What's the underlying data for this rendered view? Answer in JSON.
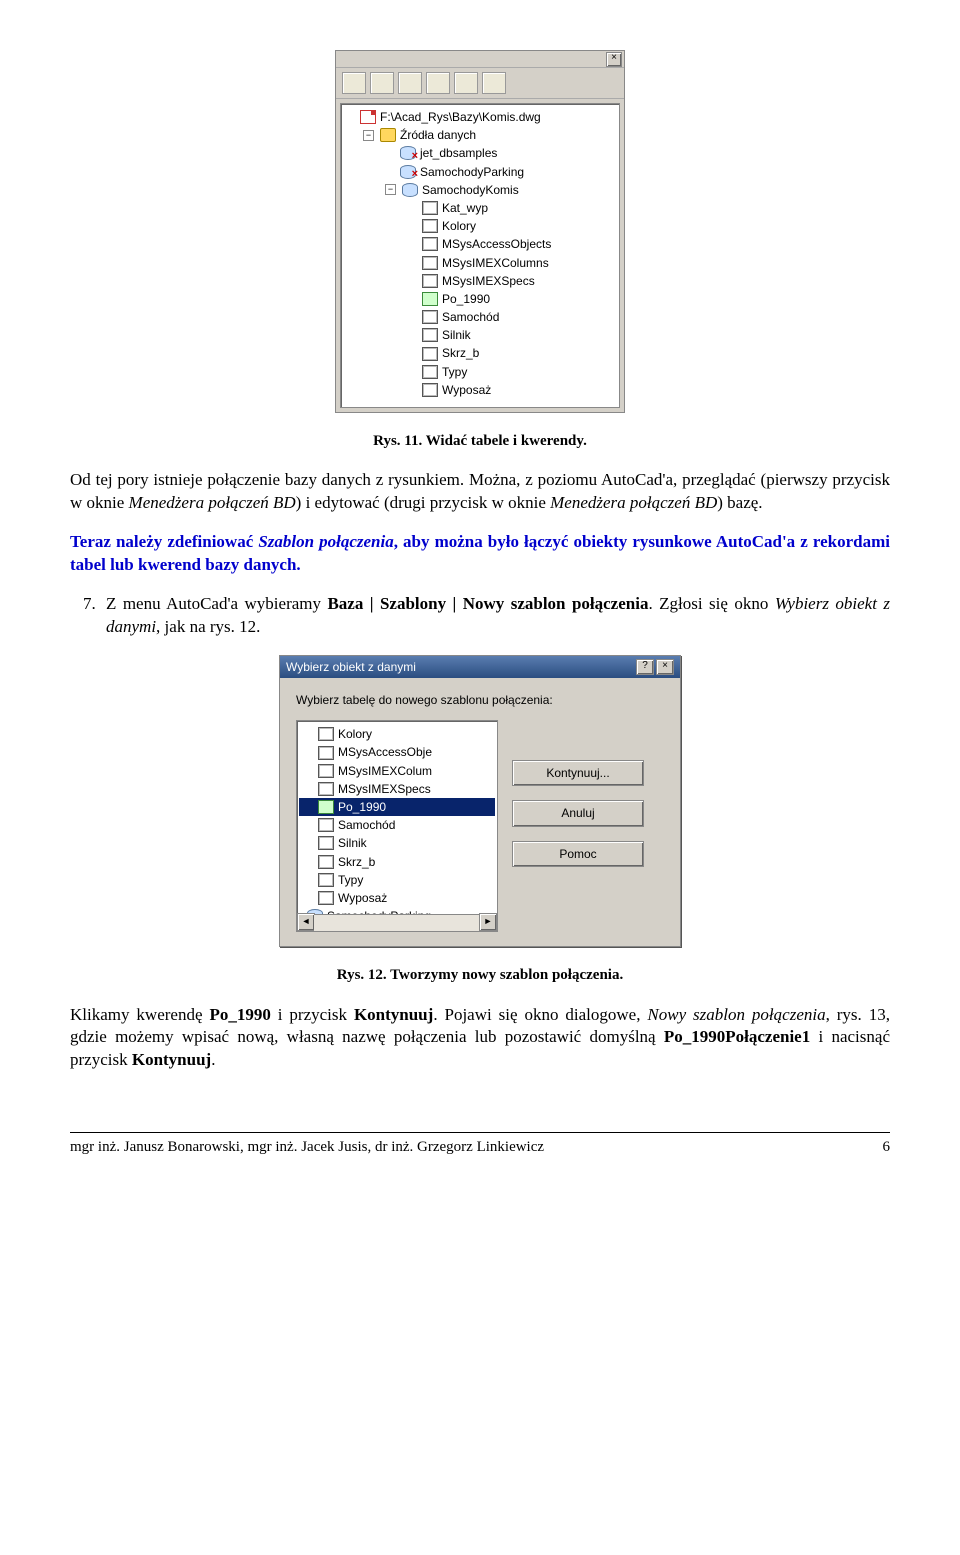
{
  "panel1": {
    "file_path": "F:\\Acad_Rys\\Bazy\\Komis.dwg",
    "root_label": "Źródła danych",
    "sources": [
      {
        "name": "jet_dbsamples",
        "broken": true
      },
      {
        "name": "SamochodyParking",
        "broken": true
      },
      {
        "name": "SamochodyKomis",
        "broken": false
      }
    ],
    "komis_children": [
      {
        "name": "Kat_wyp",
        "type": "table"
      },
      {
        "name": "Kolory",
        "type": "table"
      },
      {
        "name": "MSysAccessObjects",
        "type": "table"
      },
      {
        "name": "MSysIMEXColumns",
        "type": "table"
      },
      {
        "name": "MSysIMEXSpecs",
        "type": "table"
      },
      {
        "name": "Po_1990",
        "type": "query"
      },
      {
        "name": "Samochód",
        "type": "table"
      },
      {
        "name": "Silnik",
        "type": "table"
      },
      {
        "name": "Skrz_b",
        "type": "table"
      },
      {
        "name": "Typy",
        "type": "table"
      },
      {
        "name": "Wyposaż",
        "type": "table"
      }
    ]
  },
  "caption1": "Rys. 11. Widać tabele i kwerendy.",
  "para1_a": "Od tej pory istnieje połączenie bazy danych z rysunkiem. Można, z poziomu AutoCad'a, przeglądać (pierwszy przycisk w oknie ",
  "para1_i1": "Menedżera połączeń BD",
  "para1_b": ") i edytować (drugi przycisk w oknie ",
  "para1_i2": "Menedżera połączeń BD",
  "para1_c": ") bazę.",
  "para2_a": "Teraz należy zdefiniować ",
  "para2_i": "Szablon połączenia",
  "para2_b": ", aby można było łączyć obiekty rysunkowe AutoCad'a z rekordami  tabel lub kwerend bazy danych.",
  "step7_a": "Z menu AutoCad'a wybieramy ",
  "step7_b1": "Baza | Szablony | Nowy szablon połączenia",
  "step7_b": ". Zgłosi się okno ",
  "step7_i": "Wybierz obiekt z danymi",
  "step7_c": ", jak na rys. 12.",
  "dialog": {
    "title": "Wybierz obiekt z danymi",
    "prompt": "Wybierz tabelę do nowego szablonu połączenia:",
    "items": [
      {
        "name": "Kolory",
        "type": "table"
      },
      {
        "name": "MSysAccessObje",
        "type": "table"
      },
      {
        "name": "MSysIMEXColum",
        "type": "table"
      },
      {
        "name": "MSysIMEXSpecs",
        "type": "table"
      },
      {
        "name": "Po_1990",
        "type": "query",
        "selected": true
      },
      {
        "name": "Samochód",
        "type": "table"
      },
      {
        "name": "Silnik",
        "type": "table"
      },
      {
        "name": "Skrz_b",
        "type": "table"
      },
      {
        "name": "Typy",
        "type": "table"
      },
      {
        "name": "Wyposaż",
        "type": "table"
      },
      {
        "name": "SamochodyParking",
        "type": "db"
      }
    ],
    "buttons": {
      "cont": "Kontynuuj...",
      "cancel": "Anuluj",
      "help": "Pomoc"
    }
  },
  "caption2": "Rys. 12. Tworzymy nowy szablon połączenia.",
  "para3_a": "Klikamy kwerendę ",
  "para3_b1": "Po_1990",
  "para3_b": " i przycisk ",
  "para3_b2": "Kontynuuj",
  "para3_c": ". Pojawi się okno dialogowe, ",
  "para3_i": "Nowy szablon połączenia",
  "para3_d": ", rys. 13, gdzie możemy wpisać nową, własną nazwę połączenia lub pozostawić domyślną ",
  "para3_b3": "Po_1990Połączenie1",
  "para3_e": " i nacisnąć przycisk ",
  "para3_b4": "Kontynuuj",
  "para3_f": ".",
  "footer": {
    "authors": "mgr inż. Janusz Bonarowski, mgr inż. Jacek Jusis, dr inż. Grzegorz Linkiewicz",
    "page": "6"
  }
}
